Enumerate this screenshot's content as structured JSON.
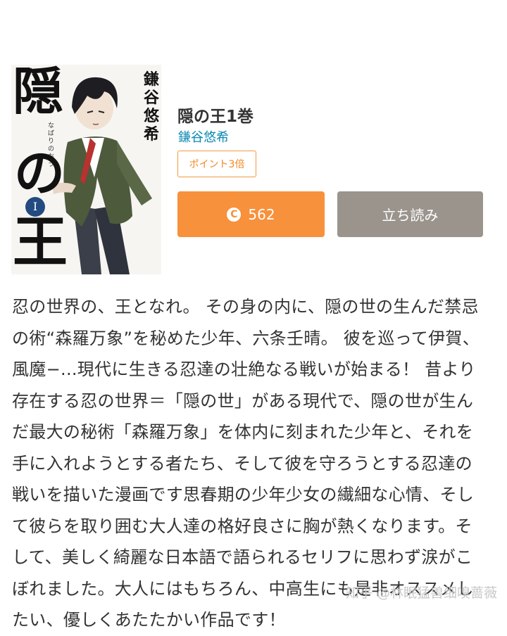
{
  "book": {
    "title": "隠の王1巻",
    "author": "鎌谷悠希",
    "badge": "ポイント3倍",
    "cover": {
      "title_top": "隠",
      "title_mid": "の",
      "title_bottom": "王",
      "volume": "Ⅰ",
      "reading": "なばりのおう",
      "author": "鎌谷悠希"
    }
  },
  "buttons": {
    "buy_price": "562",
    "coin_symbol": "C",
    "preview_label": "立ち読み"
  },
  "description": "忍の世界の、王となれ。 その身の内に、隠の世の生んだ禁忌の術“森羅万象”を秘めた少年、六条壬晴。 彼を巡って伊賀、風魔−...現代に生きる忍達の壮絶なる戦いが始まる！ 昔より存在する忍の世界＝「隠の世」がある現代で、隠の世が生んだ最大の秘術「森羅万象」を体内に刻まれた少年と、それを手に入れようとする者たち、そして彼を守ろうとする忍達の戦いを描いた漫画です思春期の少年少女の繊細な心情、そして彼らを取り囲む大人達の格好良さに胸が熱くなります。そして、美しく綺麗な日本語で語られるセリフに思わず涙がこぼれました。大人にはもちろん、中高生にも是非オススメしたい、優しくあたたかい作品です！",
  "watermark": "知乎 @林眠猛兽细嗅蔷薇",
  "colors": {
    "buy_button": "#f7913b",
    "preview_button": "#9a948d",
    "author_link": "#0b8ab3",
    "badge": "#f08a23"
  }
}
